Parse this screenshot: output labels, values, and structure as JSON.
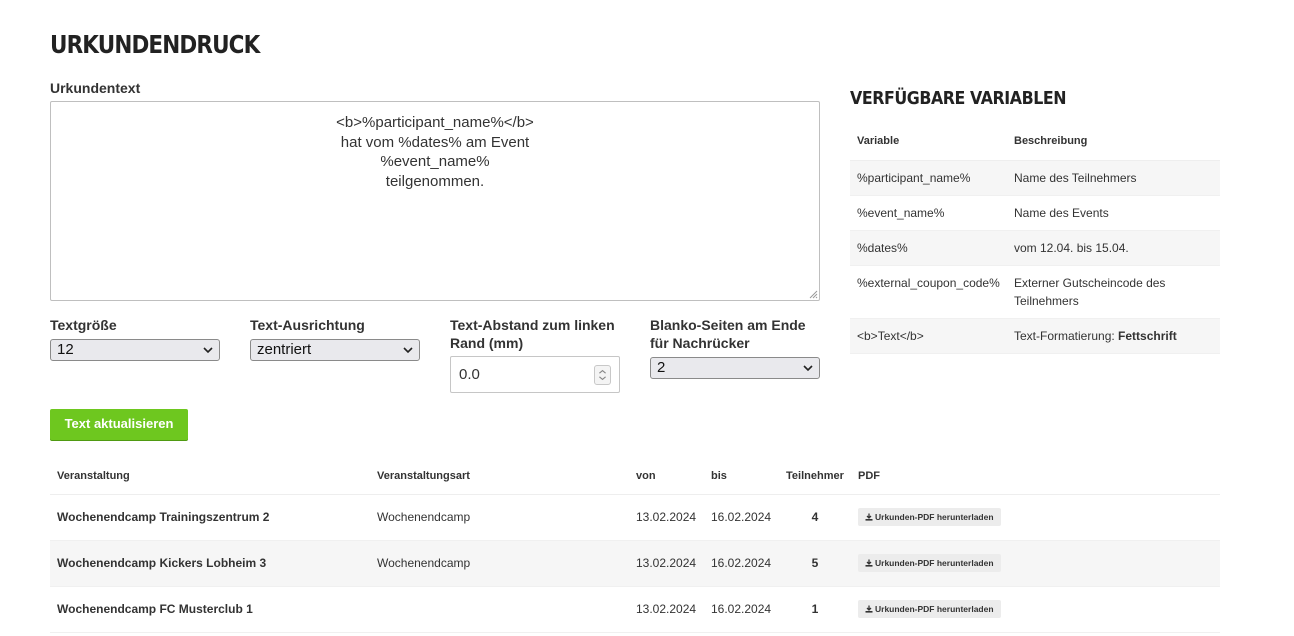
{
  "page": {
    "title": "URKUNDENDRUCK"
  },
  "certificate": {
    "label": "Urkundentext",
    "lines": [
      "<b>%participant_name%</b>",
      "hat vom %dates% am Event",
      "%event_name%",
      "teilgenommen."
    ]
  },
  "options": {
    "font_size": {
      "label": "Textgröße",
      "value": "12"
    },
    "alignment": {
      "label": "Text-Ausrichtung",
      "value": "zentriert"
    },
    "margin": {
      "label_line1": "Text-Abstand zum linken",
      "label_line2": "Rand (mm)",
      "value": "0.0"
    },
    "blank_pages": {
      "label_line1": "Blanko-Seiten am Ende",
      "label_line2": "für Nachrücker",
      "value": "2"
    }
  },
  "update_button": {
    "label": "Text aktualisieren"
  },
  "variables": {
    "title": "VERFÜGBARE VARIABLEN",
    "headers": {
      "variable": "Variable",
      "description": "Beschreibung"
    },
    "rows": [
      {
        "variable": "%participant_name%",
        "description": "Name des Teilnehmers"
      },
      {
        "variable": "%event_name%",
        "description": "Name des Events"
      },
      {
        "variable": "%dates%",
        "description": "vom 12.04. bis 15.04."
      },
      {
        "variable": "%external_coupon_code%",
        "description_line1": "Externer Gutscheincode des",
        "description_line2": "Teilnehmers"
      },
      {
        "variable": "<b>Text</b>",
        "description_prefix": "Text-Formatierung: ",
        "description_bold": "Fettschrift"
      }
    ]
  },
  "events": {
    "headers": {
      "event": "Veranstaltung",
      "type": "Veranstaltungsart",
      "from": "von",
      "to": "bis",
      "participants": "Teilnehmer",
      "pdf": "PDF"
    },
    "rows": [
      {
        "name": "Wochenendcamp Trainingszentrum 2",
        "type": "Wochenendcamp",
        "from": "13.02.2024",
        "to": "16.02.2024",
        "participants": "4",
        "pdf": "Urkunden-PDF herunterladen"
      },
      {
        "name": "Wochenendcamp Kickers Lobheim 3",
        "type": "Wochenendcamp",
        "from": "13.02.2024",
        "to": "16.02.2024",
        "participants": "5",
        "pdf": "Urkunden-PDF herunterladen"
      },
      {
        "name": "Wochenendcamp FC Musterclub 1",
        "type": "",
        "from": "13.02.2024",
        "to": "16.02.2024",
        "participants": "1",
        "pdf": "Urkunden-PDF herunterladen"
      }
    ]
  },
  "icons": {
    "download": "download-icon",
    "dropdown": "chevron-down-icon",
    "spinner": "spinner-arrows-icon",
    "resize": "resize-grip-icon"
  },
  "colors": {
    "primary_button": "#6ec71f",
    "stripe": "#f6f6f6"
  }
}
